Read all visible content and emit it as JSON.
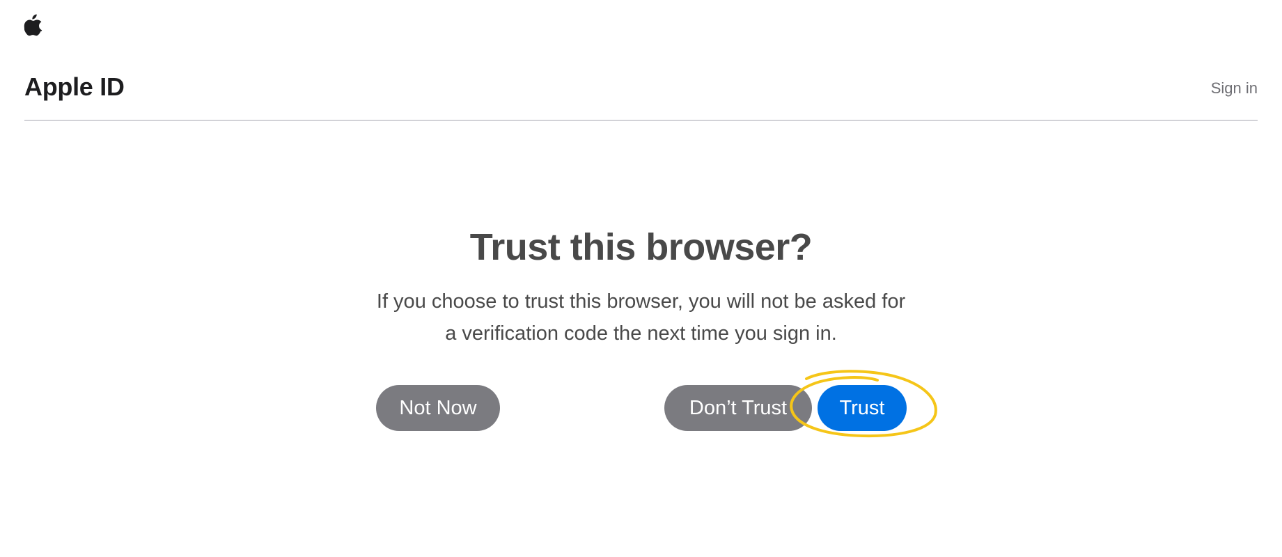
{
  "header": {
    "title": "Apple ID",
    "sign_in_label": "Sign in"
  },
  "main": {
    "heading": "Trust this browser?",
    "description": "If you choose to trust this browser, you will not be asked for a verification code the next time you sign in."
  },
  "buttons": {
    "not_now": "Not Now",
    "dont_trust": "Don’t Trust",
    "trust": "Trust"
  },
  "icons": {
    "logo": "apple-logo-icon",
    "annotation": "highlight-circle"
  },
  "colors": {
    "primary": "#0071e3",
    "secondary": "#7b7b80",
    "highlight": "#f5c518",
    "text": "#494949"
  }
}
